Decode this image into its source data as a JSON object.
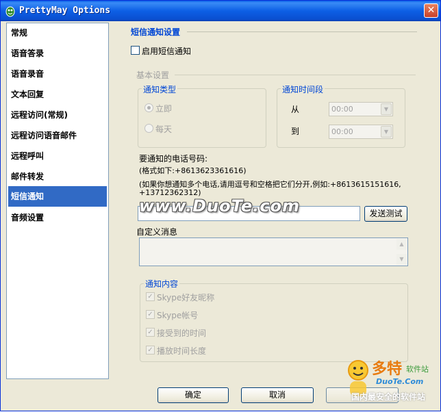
{
  "window": {
    "title": "PrettyMay Options",
    "close_glyph": "✕"
  },
  "sidebar": {
    "items": [
      {
        "label": "常规"
      },
      {
        "label": "语音答录"
      },
      {
        "label": "语音录音"
      },
      {
        "label": "文本回复"
      },
      {
        "label": "远程访问(常规)"
      },
      {
        "label": "远程访问语音邮件"
      },
      {
        "label": "远程呼叫"
      },
      {
        "label": "邮件转发"
      },
      {
        "label": "短信通知",
        "selected": true
      },
      {
        "label": "音频设置"
      }
    ]
  },
  "sms": {
    "section_title": "短信通知设置",
    "enable_label": "启用短信通知",
    "enable_checked": false,
    "basic": {
      "title": "基本设置",
      "notify_type": {
        "title": "通知类型",
        "options": [
          {
            "label": "立即",
            "checked": true
          },
          {
            "label": "每天",
            "checked": false
          }
        ]
      },
      "notify_period": {
        "title": "通知时间段",
        "from_label": "从",
        "to_label": "到",
        "from_value": "00:00",
        "to_value": "00:00"
      }
    },
    "phone": {
      "label": "要通知的电话号码:",
      "format_hint": "(格式如下:+8613623361616)",
      "multi_hint_line1": "(如果你想通知多个电话,请用逗号和空格把它们分开,例如:+8613615151616,",
      "multi_hint_line2": "+13712362312)",
      "value": "",
      "send_test_label": "发送测试"
    },
    "custom_message": {
      "label": "自定义消息",
      "value": ""
    },
    "content": {
      "title": "通知内容",
      "items": [
        {
          "label": "Skype好友昵称",
          "checked": true
        },
        {
          "label": "Skype帐号",
          "checked": true
        },
        {
          "label": "接受到的时间",
          "checked": true
        },
        {
          "label": "播放时间长度",
          "checked": true
        }
      ]
    }
  },
  "footer": {
    "ok_label": "确定",
    "cancel_label": "取消"
  },
  "watermark": {
    "text": "www.DuoTe.com",
    "logo_cn": "多特",
    "logo_sub": "软件站",
    "logo_site": "DuoTe.Com",
    "logo_slogan": "国内最安全的软件站"
  },
  "colors": {
    "titlebar": "#0a5ee8",
    "selection": "#316ac5",
    "group_title": "#0046d5",
    "dialog_bg": "#ece9d8"
  },
  "icons": {
    "app": "prettymay-app-icon",
    "close": "close-icon"
  }
}
